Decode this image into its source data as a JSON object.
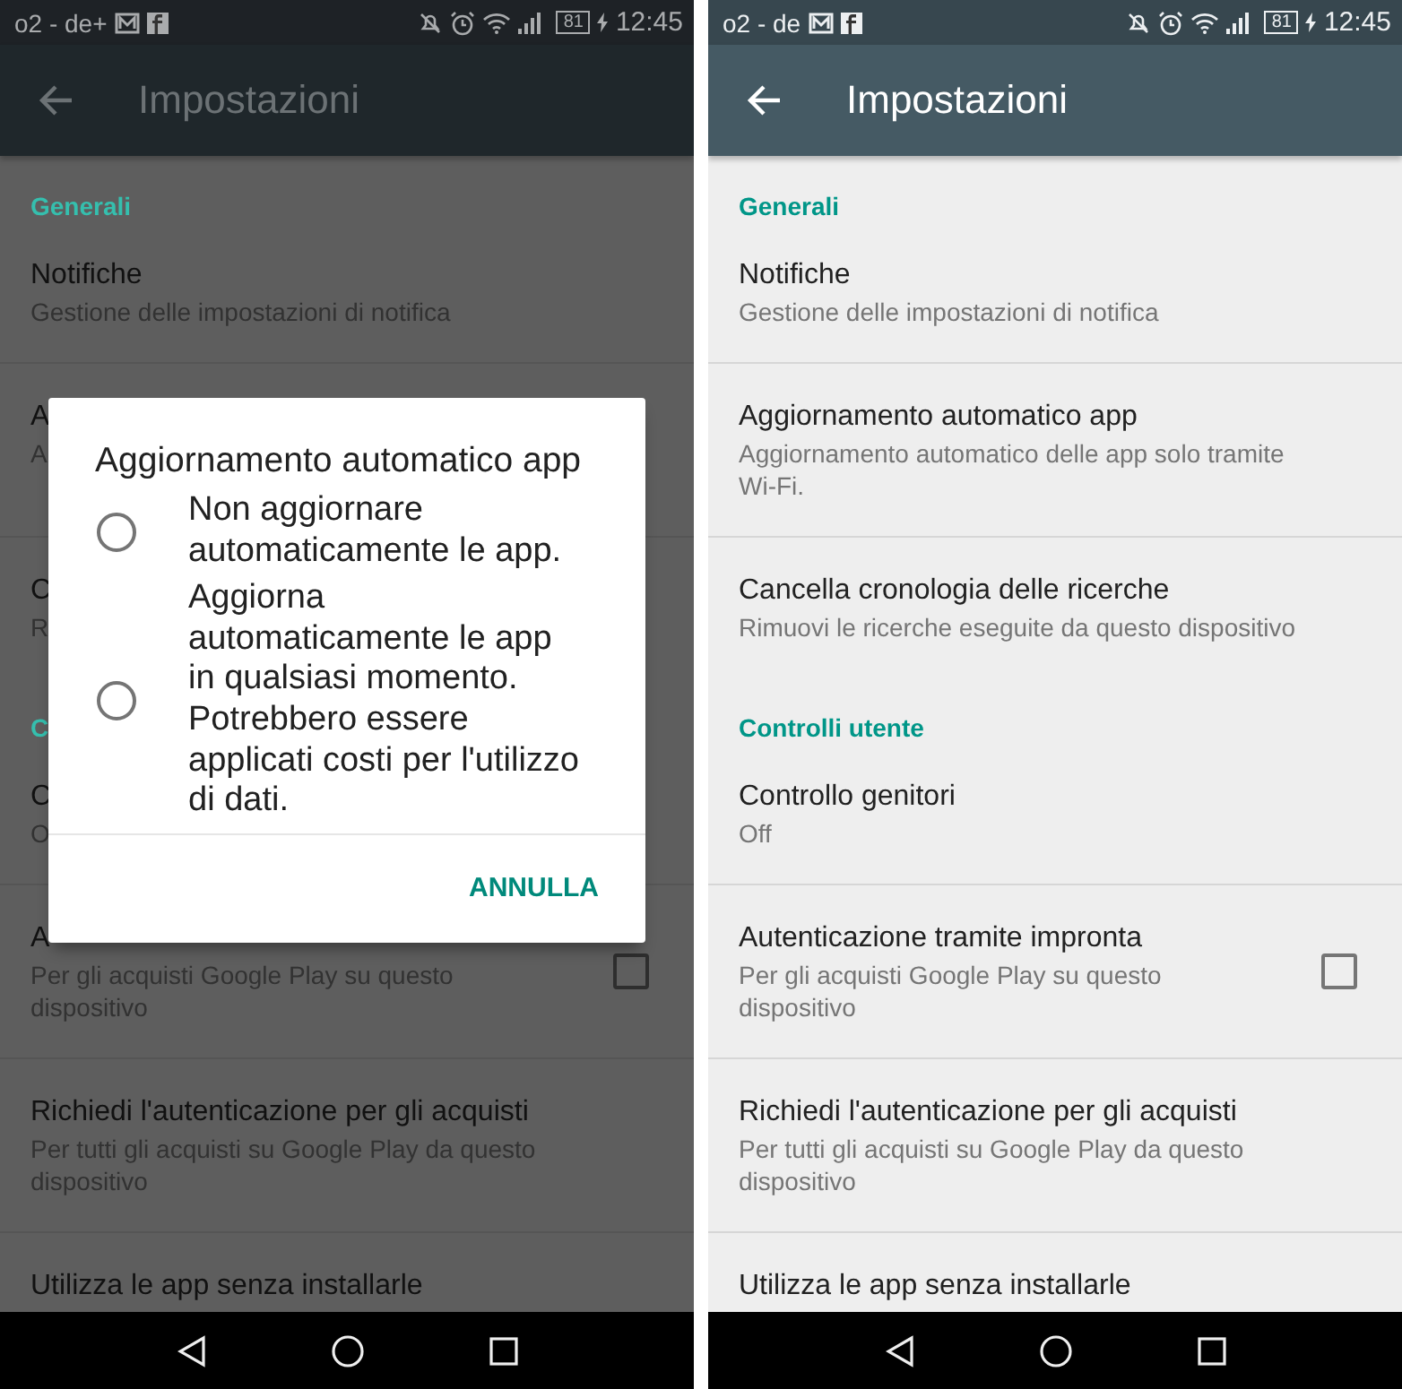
{
  "phones": [
    {
      "dimmed": true,
      "status": {
        "carrier": "o2 - de+",
        "battery": "81",
        "time": "12:45"
      },
      "title": "Impostazioni",
      "list": [
        {
          "kind": "header",
          "title": "Generali"
        },
        {
          "kind": "item",
          "title": "Notifiche",
          "subtitle": "Gestione delle impostazioni di notifica"
        },
        {
          "kind": "item",
          "title": "A",
          "subtitle": "A"
        },
        {
          "kind": "item",
          "title": "C",
          "subtitle": "R"
        },
        {
          "kind": "header",
          "title": "C"
        },
        {
          "kind": "item",
          "title": "C",
          "subtitle": "O"
        },
        {
          "kind": "checkbox",
          "title": "A",
          "subtitle": "Per gli acquisti Google Play su questo dispositivo",
          "checked": false
        },
        {
          "kind": "item",
          "title": "Richiedi l'autenticazione per gli acquisti",
          "subtitle": "Per tutti gli acquisti su Google Play da questo dispositivo"
        },
        {
          "kind": "item",
          "title": "Utilizza le app senza installarle"
        }
      ],
      "dialog": {
        "title": "Aggiornamento automatico app",
        "options": [
          {
            "label": "Non aggiornare\nautomaticamente le app.",
            "selected": false
          },
          {
            "label": "Aggiorna\nautomaticamente le app\nin qualsiasi momento.\nPotrebbero essere\napplicati costi per l'utilizzo\ndi dati.",
            "selected": false
          }
        ],
        "button": "ANNULLA"
      }
    },
    {
      "dimmed": false,
      "status": {
        "carrier": "o2 - de",
        "battery": "81",
        "time": "12:45"
      },
      "title": "Impostazioni",
      "list": [
        {
          "kind": "header",
          "title": "Generali"
        },
        {
          "kind": "item",
          "title": "Notifiche",
          "subtitle": "Gestione delle impostazioni di notifica"
        },
        {
          "kind": "item",
          "title": "Aggiornamento automatico app",
          "subtitle": "Aggiornamento automatico delle app solo tramite Wi-Fi."
        },
        {
          "kind": "item",
          "title": "Cancella cronologia delle ricerche",
          "subtitle": "Rimuovi le ricerche eseguite da questo dispositivo"
        },
        {
          "kind": "header",
          "title": "Controlli utente"
        },
        {
          "kind": "item",
          "title": "Controllo genitori",
          "subtitle": "Off"
        },
        {
          "kind": "checkbox",
          "title": "Autenticazione tramite impronta",
          "subtitle": "Per gli acquisti Google Play su questo dispositivo",
          "checked": false
        },
        {
          "kind": "item",
          "title": "Richiedi l'autenticazione per gli acquisti",
          "subtitle": "Per tutti gli acquisti su Google Play da questo dispositivo"
        },
        {
          "kind": "item",
          "title": "Utilizza le app senza installarle"
        }
      ]
    }
  ]
}
